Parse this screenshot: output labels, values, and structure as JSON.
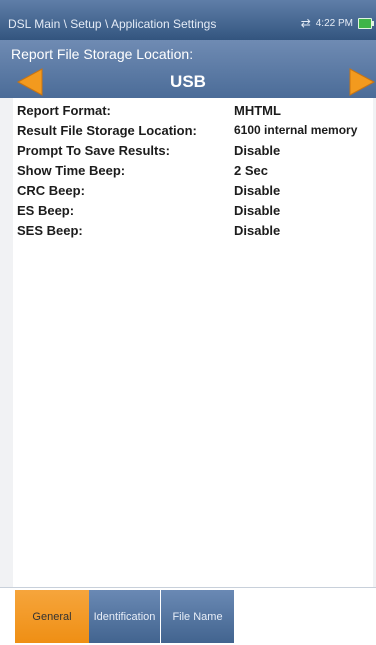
{
  "header": {
    "breadcrumb": "DSL Main \\ Setup \\ Application Settings",
    "time": "4:22 PM",
    "icons": {
      "sync": "sync-arrows-icon",
      "battery": "battery-icon"
    }
  },
  "selector": {
    "label": "Report File Storage Location:",
    "value": "USB",
    "prev_icon": "left-arrow-icon",
    "next_icon": "right-arrow-icon"
  },
  "settings": [
    {
      "label": "Report Format:",
      "value": "MHTML"
    },
    {
      "label": "Result File Storage Location:",
      "value": "6100 internal memory"
    },
    {
      "label": "Prompt To Save Results:",
      "value": "Disable"
    },
    {
      "label": "Show Time Beep:",
      "value": "2 Sec"
    },
    {
      "label": "CRC Beep:",
      "value": "Disable"
    },
    {
      "label": "ES Beep:",
      "value": "Disable"
    },
    {
      "label": "SES Beep:",
      "value": "Disable"
    }
  ],
  "tabs": [
    {
      "label": "General",
      "active": true
    },
    {
      "label": "Identification",
      "active": false
    },
    {
      "label": "File Name",
      "active": false
    }
  ],
  "colors": {
    "header_bg": "#33557f",
    "selector_bg": "#5a7aa5",
    "arrow_orange": "#f39a1e",
    "tab_active": "#f29a25",
    "tab_inactive": "#4f709c"
  }
}
